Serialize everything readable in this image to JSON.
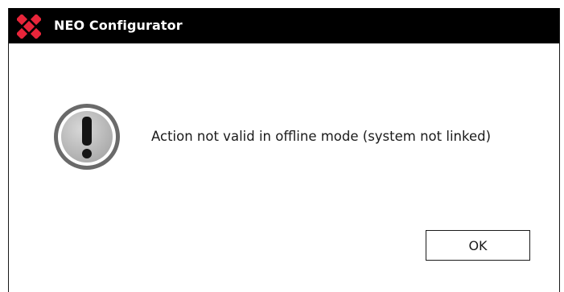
{
  "window": {
    "title": "NEO Configurator",
    "logo_icon": "neo-logo-icon",
    "accent_color": "#e8253a"
  },
  "dialog": {
    "icon": "warning-exclamation-icon",
    "message": "Action not valid in offline mode (system not linked)",
    "ok_label": "OK"
  }
}
